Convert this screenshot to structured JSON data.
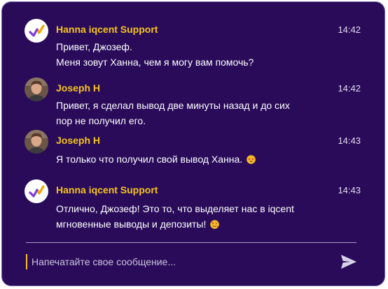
{
  "chat": {
    "messages": [
      {
        "sender": "Hanna iqcent Support",
        "time": "14:42",
        "avatar": "iqcent-logo-icon",
        "lines": [
          "Привет, Джозеф.",
          "Меня зовут Ханна, чем я могу вам помочь?"
        ]
      },
      {
        "sender": "Joseph H",
        "time": "14:42",
        "avatar": "user-photo",
        "lines": [
          "Привет, я сделал вывод две минуты назад и до сих",
          "пор не получил его."
        ]
      },
      {
        "sender": "Joseph H",
        "time": "14:43",
        "avatar": "user-photo",
        "lines": [
          "Я только что получил свой вывод Ханна."
        ],
        "emoji": "star-struck-emoji-icon"
      },
      {
        "sender": "Hanna iqcent Support",
        "time": "14:43",
        "avatar": "iqcent-logo-icon",
        "lines": [
          "Отлично, Джозеф! Это то, что выделяет нас в iqcent",
          "мгновенные выводы и депозиты!"
        ],
        "emoji": "smiling-face-with-hearts-emoji-icon"
      }
    ],
    "input": {
      "placeholder": "Напечатайте свое сообщение...",
      "value": ""
    },
    "send_icon": "send-icon"
  },
  "colors": {
    "background": "#2a0b5a",
    "sender": "#f5c518",
    "text": "#ffffff",
    "accent_caret": "#f5c518"
  }
}
